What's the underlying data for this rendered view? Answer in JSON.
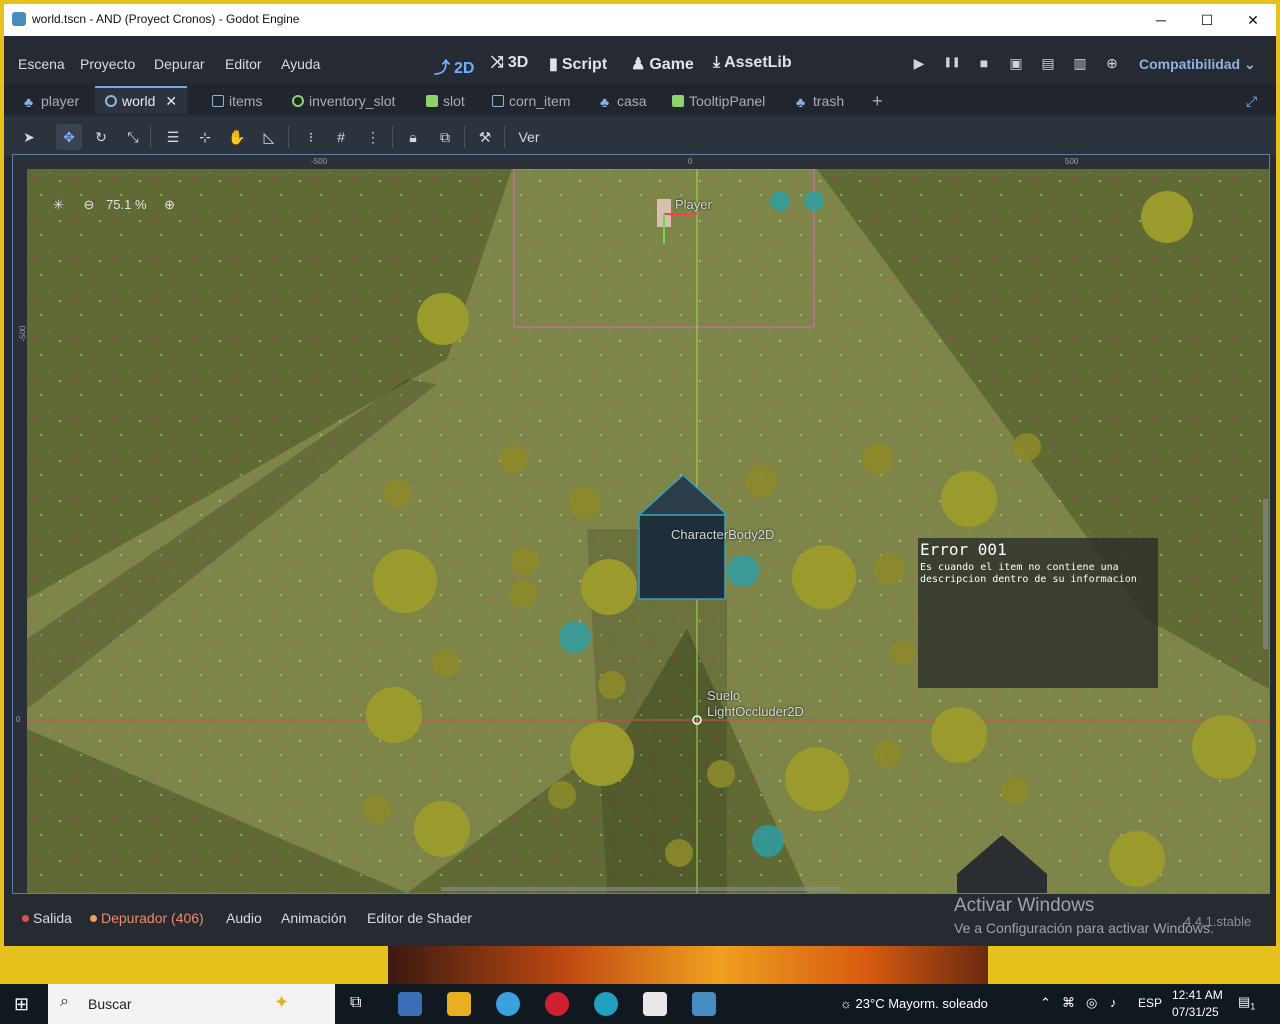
{
  "window": {
    "title": "world.tscn - AND (Proyect Cronos) - Godot Engine",
    "minimize": "─",
    "maximize": "☐",
    "close": "✕"
  },
  "menu": [
    "Escena",
    "Proyecto",
    "Depurar",
    "Editor",
    "Ayuda"
  ],
  "modes": [
    {
      "icon": "⤴",
      "label": "2D",
      "active": true
    },
    {
      "icon": "⤨",
      "label": "3D"
    },
    {
      "icon": "▮",
      "label": "Script"
    },
    {
      "icon": "♟",
      "label": "Game"
    },
    {
      "icon": "⤓",
      "label": "AssetLib"
    }
  ],
  "run_buttons": [
    "▶",
    "❚❚",
    "■",
    "▣",
    "▤",
    "▥",
    "⊕"
  ],
  "renderer": "Compatibilidad",
  "tabs": [
    {
      "label": "player",
      "icon": "node"
    },
    {
      "label": "world",
      "icon": "circle",
      "active": true
    },
    {
      "label": "items",
      "icon": "square"
    },
    {
      "label": "inventory_slot",
      "icon": "circle-green"
    },
    {
      "label": "slot",
      "icon": "panel"
    },
    {
      "label": "corn_item",
      "icon": "square"
    },
    {
      "label": "casa",
      "icon": "node"
    },
    {
      "label": "TooltipPanel",
      "icon": "panel"
    },
    {
      "label": "trash",
      "icon": "node"
    }
  ],
  "tab_close": "✕",
  "tab_add": "+",
  "toolbar": {
    "view_label": "Ver"
  },
  "viewport": {
    "zoom": "75.1 %",
    "ruler_top": [
      "-500",
      "0",
      "500"
    ],
    "ruler_left": [
      "-500",
      "0"
    ],
    "nodes": [
      "Player",
      "CharacterBody2D",
      "Suelo",
      "LightOccluder2D"
    ],
    "tooltip": {
      "title": "Error 001",
      "body": "Es cuando el item no contiene una descripcion dentro de su informacion"
    }
  },
  "bottom_tabs": [
    {
      "label": "Salida",
      "dot": "#e05050"
    },
    {
      "label": "Depurador (406)",
      "dot": "#f0a050",
      "warning": true
    },
    {
      "label": "Audio"
    },
    {
      "label": "Animación"
    },
    {
      "label": "Editor de Shader"
    }
  ],
  "watermark": {
    "line1": "Activar Windows",
    "line2": "Ve a Configuración para activar Windows."
  },
  "version": "4.4.1.stable",
  "taskbar": {
    "search": "Buscar",
    "weather": "23°C  Mayorm. soleado",
    "lang": "ESP",
    "time": "12:41 AM",
    "date": "07/31/25",
    "notifications": "1"
  }
}
